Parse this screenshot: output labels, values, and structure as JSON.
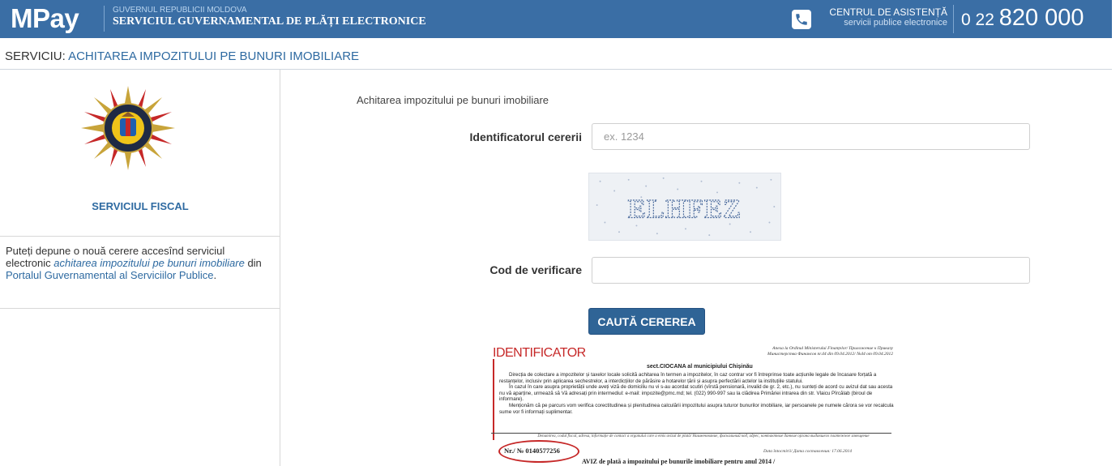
{
  "header": {
    "logo": "MPay",
    "gov_small": "GUVERNUL REPUBLICII MOLDOVA",
    "gov_big": "SERVICIUL GUVERNAMENTAL DE PLĂȚI ELECTRONICE",
    "support_title": "CENTRUL DE ASISTENȚĂ",
    "support_sub": "servicii publice electronice",
    "phone_prefix": "0 22",
    "phone_main": "820 000",
    "phone_icon": "phone-icon"
  },
  "service": {
    "label": "SERVICIU:",
    "name": "ACHITAREA IMPOZITULUI PE BUNURI IMOBILIARE"
  },
  "sidebar": {
    "emblem_text_top": "SERVICIUL",
    "emblem_text_bottom": "FISCAL",
    "agency": "SERVICIUL FISCAL",
    "text_1": "Puteți depune o nouă cerere accesînd serviciul electronic ",
    "link": "achitarea impozitului pe bunuri imobiliare",
    "text_2": " din ",
    "portal": "Portalul Guvernamental al Serviciilor Publice",
    "text_3": "."
  },
  "form": {
    "heading": "Achitarea impozitului pe bunuri imobiliare",
    "id_label": "Identificatorul cererii",
    "id_placeholder": "ex. 1234",
    "id_value": "",
    "captcha_text": "ELHFEZ",
    "code_label": "Cod de verificare",
    "code_value": "",
    "search_button": "CAUTĂ CEREREA"
  },
  "sample_doc": {
    "identificator": "IDENTIFICATOR",
    "annex": "Anexa la Ordinul Ministerului Finanțelor/ Приложение к Приказу Министерства Финансов nr.44 din 09.04.2012/ №44 от 09.04.2012",
    "sect": "sect.CIOCANA al municipiului Chișinău",
    "para1": "Direcția de colectare a impozitelor și taxelor locale solicită achitarea în termen a impozitelor, în caz contrar vor fi întreprinse toate acțiunile legale de încasare forțată a restanțelor, inclusiv prin aplicarea sechestrelor, a interdicțiilor de părăsire a hotarelor țării și asupra perfectării actelor la instituțiile statului.",
    "para2": "În cazul în care asupra proprietății unde aveți viză de domiciliu nu vi s-au acordat scutiri (vîrstă pensionară, invalid de gr. 2, etc.), nu sunteți de acord cu avizul dat sau acesta nu vă aparține, urmează să Vă adresați prin intermediul: e-mail: impozite@pmc.md; tel. (022) 990-997 sau la clădirea Primăriei intrarea din str. Vlaicu Pîrcălab (biroul de informare).",
    "para3": "Menționăm că pe parcurs vom verifica corectitudinea și plenitudinea calculării impozitului asupra tuturor bunurilor imobiliare, iar persoanele pe numele cărora se vor recalcula sume vor fi informați suplimentar.",
    "note": "Denumirea, codul fiscal, adresa, informație de contact a organului care a emis avizul de plată/ Наименование, фискальный код, адрес, контактные данные органа выдавшего платежное извещение",
    "nr": "Nr./ №  0140577256",
    "date": "Data întocmirii/ Дата составления: 17.06.2014",
    "aviz": "AVIZ de plată  a impozitului pe bunurile imobiliare pentru anul 2014 /"
  },
  "colors": {
    "header_bg": "#3a6ea5",
    "accent": "#2e6aa1",
    "button_bg": "#2f6496",
    "highlight_red": "#c62828"
  }
}
